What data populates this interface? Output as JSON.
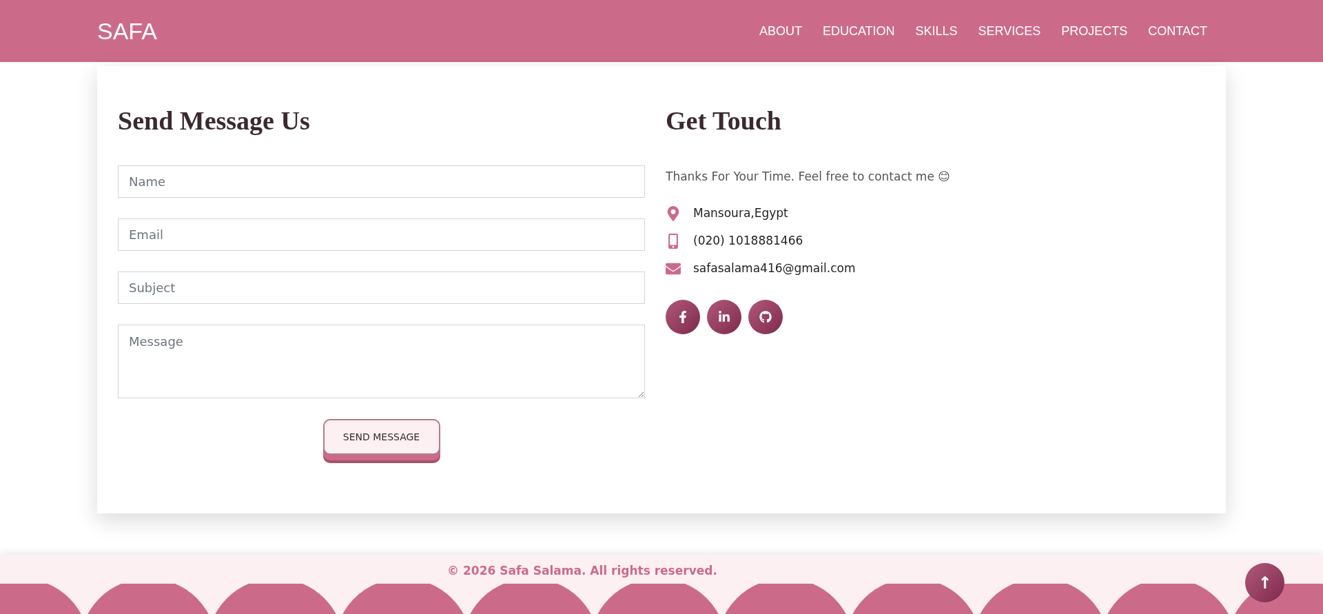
{
  "brand": "SAFA",
  "nav": [
    {
      "label": "ABOUT"
    },
    {
      "label": "EDUCATION"
    },
    {
      "label": "SKILLS"
    },
    {
      "label": "SERVICES"
    },
    {
      "label": "PROJECTS"
    },
    {
      "label": "CONTACT"
    }
  ],
  "form": {
    "title": "Send Message Us",
    "fields": [
      {
        "kind": "input",
        "placeholder": "Name"
      },
      {
        "kind": "input",
        "placeholder": "Email"
      },
      {
        "kind": "input",
        "placeholder": "Subject"
      },
      {
        "kind": "textarea",
        "placeholder": "Message"
      }
    ],
    "button": "SEND MESSAGE"
  },
  "contact": {
    "title": "Get Touch",
    "intro": "Thanks For Your Time. Feel free to contact me 😊",
    "items": [
      {
        "kind": "location",
        "text": "Mansoura,Egypt"
      },
      {
        "kind": "phone",
        "text": "(020) 1018881466"
      },
      {
        "kind": "email",
        "text": "safasalama416@gmail.com"
      }
    ],
    "socials": [
      {
        "kind": "facebook"
      },
      {
        "kind": "linkedin"
      },
      {
        "kind": "github"
      }
    ]
  },
  "footer": {
    "copyright": "© 2026 Safa Salama. All rights reserved.",
    "back_to_top": "↑"
  }
}
